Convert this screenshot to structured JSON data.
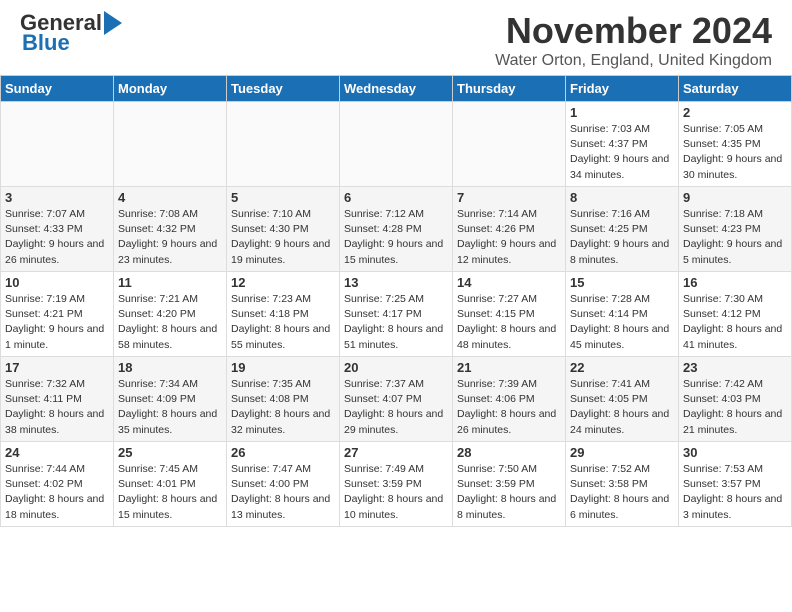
{
  "header": {
    "logo_general": "General",
    "logo_blue": "Blue",
    "month_title": "November 2024",
    "location": "Water Orton, England, United Kingdom"
  },
  "days_of_week": [
    "Sunday",
    "Monday",
    "Tuesday",
    "Wednesday",
    "Thursday",
    "Friday",
    "Saturday"
  ],
  "weeks": [
    [
      {
        "day": null
      },
      {
        "day": null
      },
      {
        "day": null
      },
      {
        "day": null
      },
      {
        "day": null
      },
      {
        "day": "1",
        "sunrise": "Sunrise: 7:03 AM",
        "sunset": "Sunset: 4:37 PM",
        "daylight": "Daylight: 9 hours and 34 minutes."
      },
      {
        "day": "2",
        "sunrise": "Sunrise: 7:05 AM",
        "sunset": "Sunset: 4:35 PM",
        "daylight": "Daylight: 9 hours and 30 minutes."
      }
    ],
    [
      {
        "day": "3",
        "sunrise": "Sunrise: 7:07 AM",
        "sunset": "Sunset: 4:33 PM",
        "daylight": "Daylight: 9 hours and 26 minutes."
      },
      {
        "day": "4",
        "sunrise": "Sunrise: 7:08 AM",
        "sunset": "Sunset: 4:32 PM",
        "daylight": "Daylight: 9 hours and 23 minutes."
      },
      {
        "day": "5",
        "sunrise": "Sunrise: 7:10 AM",
        "sunset": "Sunset: 4:30 PM",
        "daylight": "Daylight: 9 hours and 19 minutes."
      },
      {
        "day": "6",
        "sunrise": "Sunrise: 7:12 AM",
        "sunset": "Sunset: 4:28 PM",
        "daylight": "Daylight: 9 hours and 15 minutes."
      },
      {
        "day": "7",
        "sunrise": "Sunrise: 7:14 AM",
        "sunset": "Sunset: 4:26 PM",
        "daylight": "Daylight: 9 hours and 12 minutes."
      },
      {
        "day": "8",
        "sunrise": "Sunrise: 7:16 AM",
        "sunset": "Sunset: 4:25 PM",
        "daylight": "Daylight: 9 hours and 8 minutes."
      },
      {
        "day": "9",
        "sunrise": "Sunrise: 7:18 AM",
        "sunset": "Sunset: 4:23 PM",
        "daylight": "Daylight: 9 hours and 5 minutes."
      }
    ],
    [
      {
        "day": "10",
        "sunrise": "Sunrise: 7:19 AM",
        "sunset": "Sunset: 4:21 PM",
        "daylight": "Daylight: 9 hours and 1 minute."
      },
      {
        "day": "11",
        "sunrise": "Sunrise: 7:21 AM",
        "sunset": "Sunset: 4:20 PM",
        "daylight": "Daylight: 8 hours and 58 minutes."
      },
      {
        "day": "12",
        "sunrise": "Sunrise: 7:23 AM",
        "sunset": "Sunset: 4:18 PM",
        "daylight": "Daylight: 8 hours and 55 minutes."
      },
      {
        "day": "13",
        "sunrise": "Sunrise: 7:25 AM",
        "sunset": "Sunset: 4:17 PM",
        "daylight": "Daylight: 8 hours and 51 minutes."
      },
      {
        "day": "14",
        "sunrise": "Sunrise: 7:27 AM",
        "sunset": "Sunset: 4:15 PM",
        "daylight": "Daylight: 8 hours and 48 minutes."
      },
      {
        "day": "15",
        "sunrise": "Sunrise: 7:28 AM",
        "sunset": "Sunset: 4:14 PM",
        "daylight": "Daylight: 8 hours and 45 minutes."
      },
      {
        "day": "16",
        "sunrise": "Sunrise: 7:30 AM",
        "sunset": "Sunset: 4:12 PM",
        "daylight": "Daylight: 8 hours and 41 minutes."
      }
    ],
    [
      {
        "day": "17",
        "sunrise": "Sunrise: 7:32 AM",
        "sunset": "Sunset: 4:11 PM",
        "daylight": "Daylight: 8 hours and 38 minutes."
      },
      {
        "day": "18",
        "sunrise": "Sunrise: 7:34 AM",
        "sunset": "Sunset: 4:09 PM",
        "daylight": "Daylight: 8 hours and 35 minutes."
      },
      {
        "day": "19",
        "sunrise": "Sunrise: 7:35 AM",
        "sunset": "Sunset: 4:08 PM",
        "daylight": "Daylight: 8 hours and 32 minutes."
      },
      {
        "day": "20",
        "sunrise": "Sunrise: 7:37 AM",
        "sunset": "Sunset: 4:07 PM",
        "daylight": "Daylight: 8 hours and 29 minutes."
      },
      {
        "day": "21",
        "sunrise": "Sunrise: 7:39 AM",
        "sunset": "Sunset: 4:06 PM",
        "daylight": "Daylight: 8 hours and 26 minutes."
      },
      {
        "day": "22",
        "sunrise": "Sunrise: 7:41 AM",
        "sunset": "Sunset: 4:05 PM",
        "daylight": "Daylight: 8 hours and 24 minutes."
      },
      {
        "day": "23",
        "sunrise": "Sunrise: 7:42 AM",
        "sunset": "Sunset: 4:03 PM",
        "daylight": "Daylight: 8 hours and 21 minutes."
      }
    ],
    [
      {
        "day": "24",
        "sunrise": "Sunrise: 7:44 AM",
        "sunset": "Sunset: 4:02 PM",
        "daylight": "Daylight: 8 hours and 18 minutes."
      },
      {
        "day": "25",
        "sunrise": "Sunrise: 7:45 AM",
        "sunset": "Sunset: 4:01 PM",
        "daylight": "Daylight: 8 hours and 15 minutes."
      },
      {
        "day": "26",
        "sunrise": "Sunrise: 7:47 AM",
        "sunset": "Sunset: 4:00 PM",
        "daylight": "Daylight: 8 hours and 13 minutes."
      },
      {
        "day": "27",
        "sunrise": "Sunrise: 7:49 AM",
        "sunset": "Sunset: 3:59 PM",
        "daylight": "Daylight: 8 hours and 10 minutes."
      },
      {
        "day": "28",
        "sunrise": "Sunrise: 7:50 AM",
        "sunset": "Sunset: 3:59 PM",
        "daylight": "Daylight: 8 hours and 8 minutes."
      },
      {
        "day": "29",
        "sunrise": "Sunrise: 7:52 AM",
        "sunset": "Sunset: 3:58 PM",
        "daylight": "Daylight: 8 hours and 6 minutes."
      },
      {
        "day": "30",
        "sunrise": "Sunrise: 7:53 AM",
        "sunset": "Sunset: 3:57 PM",
        "daylight": "Daylight: 8 hours and 3 minutes."
      }
    ]
  ]
}
